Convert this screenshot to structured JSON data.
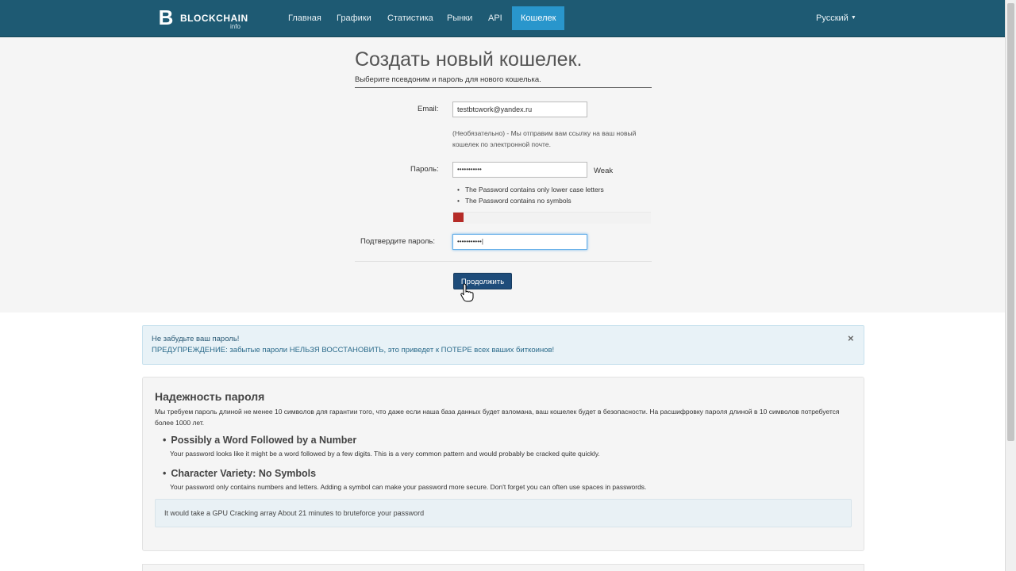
{
  "brand": {
    "mark": "B",
    "name": "BLOCKCHAIN",
    "sub": "info"
  },
  "nav": {
    "items": [
      {
        "label": "Главная"
      },
      {
        "label": "Графики"
      },
      {
        "label": "Статистика"
      },
      {
        "label": "Рынки"
      },
      {
        "label": "API"
      },
      {
        "label": "Кошелек",
        "active": true
      }
    ],
    "language": "Русский"
  },
  "form": {
    "title": "Создать новый кошелек.",
    "subtitle": "Выберите псевдоним и пароль для нового кошелька.",
    "email_label": "Email:",
    "email_value": "testbtcwork@yandex.ru",
    "email_help": "(Необязательно) - Мы отправим вам ссылку на ваш новый кошелек по электронной почте.",
    "password_label": "Пароль:",
    "password_value": "•••••••••••",
    "strength_label": "Weak",
    "password_rules": [
      "The Password contains only lower case letters",
      "The Password contains no symbols"
    ],
    "strength_level": 0.05,
    "confirm_label": "Подтвердите пароль:",
    "confirm_value": "•••••••••••",
    "continue_label": "Продолжить"
  },
  "alert": {
    "title": "Не забудьте ваш пароль!",
    "text": "ПРЕДУПРЕЖДЕНИЕ: забытые пароли НЕЛЬЗЯ ВОССТАНОВИТЬ, это приведет к ПОТЕРЕ всех ваших биткоинов!",
    "close": "×"
  },
  "strength_panel": {
    "title": "Надежность пароля",
    "description": "Мы требуем пароль длиной не менее 10 символов для гарантии того, что даже если наша база данных будет взломана, ваш кошелек будет в безопасности. На расшифровку пароля длиной в 10 символов потребуется более 1000 лет.",
    "tips": [
      {
        "heading": "Possibly a Word Followed by a Number",
        "text": "Your password looks like it might be a word followed by a few digits. This is a very common pattern and would probably be cracked quite quickly."
      },
      {
        "heading": "Character Variety: No Symbols",
        "text": "Your password only contains numbers and letters. Adding a symbol can make your password more secure. Don't forget you can often use spaces in passwords."
      }
    ],
    "crack_time": "It would take a GPU Cracking array About 21 minutes to bruteforce your password"
  },
  "colors": {
    "navbar": "#1e5a73",
    "nav_active": "#2996cc",
    "button": "#1e4c7a",
    "strength_weak": "#b52b27"
  }
}
